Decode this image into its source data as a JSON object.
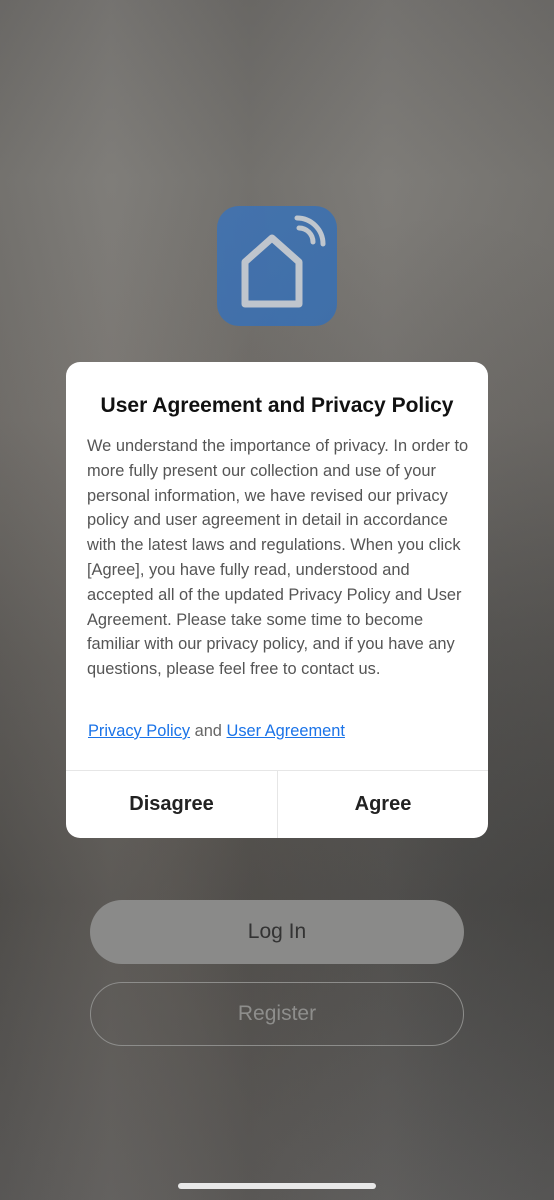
{
  "background": {
    "login_label": "Log In",
    "register_label": "Register",
    "app_icon": "smart-home-icon"
  },
  "dialog": {
    "title": "User Agreement and Privacy Policy",
    "body": "We understand the importance of privacy. In order to more fully present our collection and use of your personal information, we have revised our privacy policy and user agreement in detail in accordance with the latest laws and regulations. When you click [Agree], you have fully read, understood and accepted all of the updated Privacy Policy and User Agreement. Please take some time to become familiar with our privacy policy, and if you have any questions, please feel free to contact us.",
    "privacy_link": "Privacy Policy",
    "and_text": "and",
    "agreement_link": "User Agreement",
    "disagree_label": "Disagree",
    "agree_label": "Agree"
  },
  "colors": {
    "link": "#1a73e8",
    "app_icon_bg": "#3f73b3"
  }
}
